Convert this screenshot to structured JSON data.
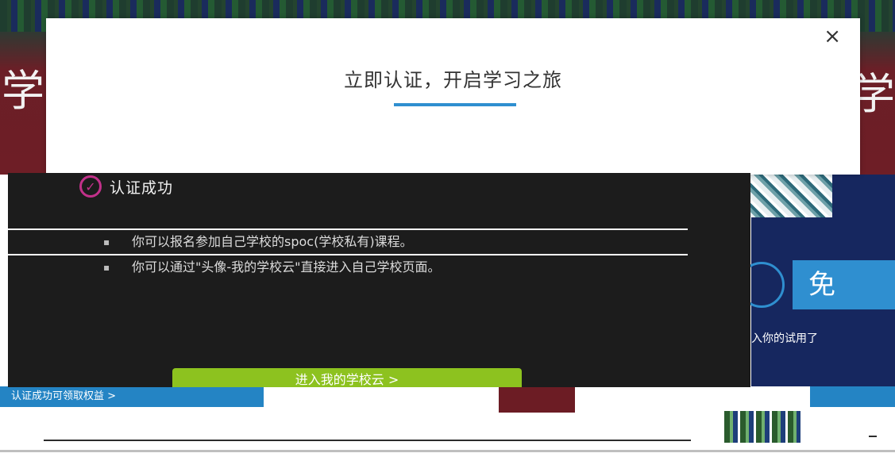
{
  "modal": {
    "title": "立即认证，开启学习之旅",
    "close_label": "×",
    "accent_color": "#2f8fd0"
  },
  "panel": {
    "heading": "认证成功",
    "icon": "check-circle-icon",
    "items": [
      "你可以报名参加自己学校的spoc(学校私有)课程。",
      "你可以通过\"头像-我的学校云\"直接进入自己学校页面。"
    ],
    "button_label": "进入我的学校云 >",
    "button_color": "#8dc21f"
  },
  "background": {
    "hero_char": "学",
    "trial_button_char": "免",
    "trial_text": "入你的试用了",
    "bottom_left_text": "认证成功可领取权益 >"
  }
}
